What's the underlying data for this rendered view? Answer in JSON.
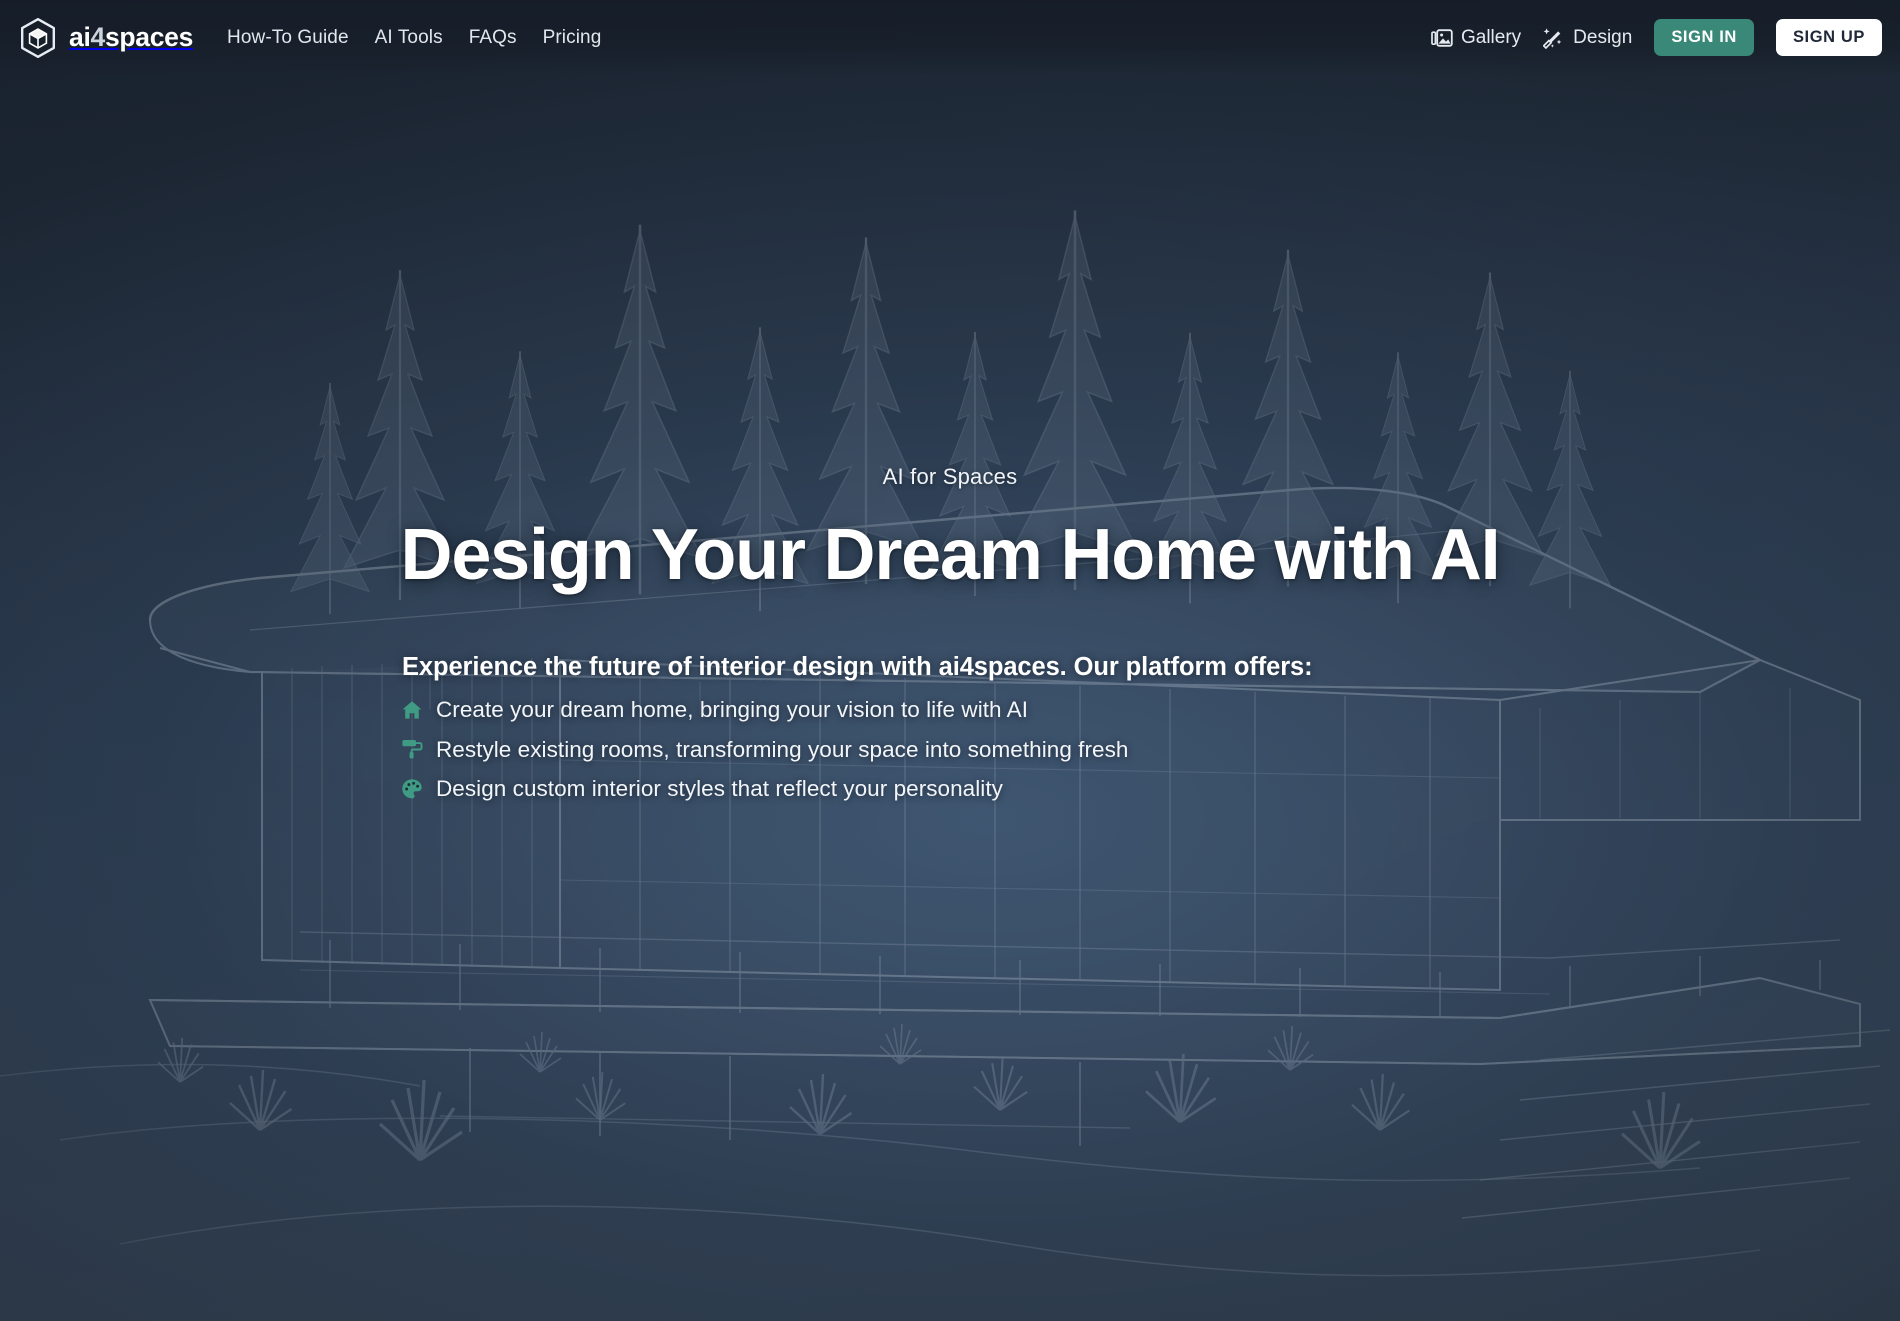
{
  "brand": {
    "logo_icon": "hexagon-cube-icon",
    "name_part1": "ai",
    "name_accent": "4",
    "name_part2": "spaces"
  },
  "nav": {
    "primary_links": [
      {
        "label": "How-To Guide"
      },
      {
        "label": "AI Tools"
      },
      {
        "label": "FAQs"
      },
      {
        "label": "Pricing"
      }
    ],
    "right_links": [
      {
        "label": "Gallery",
        "icon": "image-gallery-icon"
      },
      {
        "label": "Design",
        "icon": "magic-wand-icon"
      }
    ],
    "sign_in_label": "SIGN IN",
    "sign_up_label": "SIGN UP"
  },
  "hero": {
    "eyebrow": "AI for Spaces",
    "headline": "Design Your Dream Home with AI",
    "lead": "Experience the future of interior design with ai4spaces. Our platform offers:",
    "features": [
      {
        "icon": "home-icon",
        "text": "Create your dream home, bringing your vision to life with AI"
      },
      {
        "icon": "paint-roller-icon",
        "text": "Restyle existing rooms, transforming your space into something fresh"
      },
      {
        "icon": "palette-icon",
        "text": "Design custom interior styles that reflect your personality"
      }
    ]
  },
  "background": {
    "illustration": "modern-house-with-pine-trees-sketch"
  },
  "colors": {
    "accent_teal": "#3a8878",
    "page_dark": "#1b2533",
    "page_mid": "#2e3f54",
    "page_bottom": "#28323f",
    "text_light": "#f2f5f9"
  }
}
